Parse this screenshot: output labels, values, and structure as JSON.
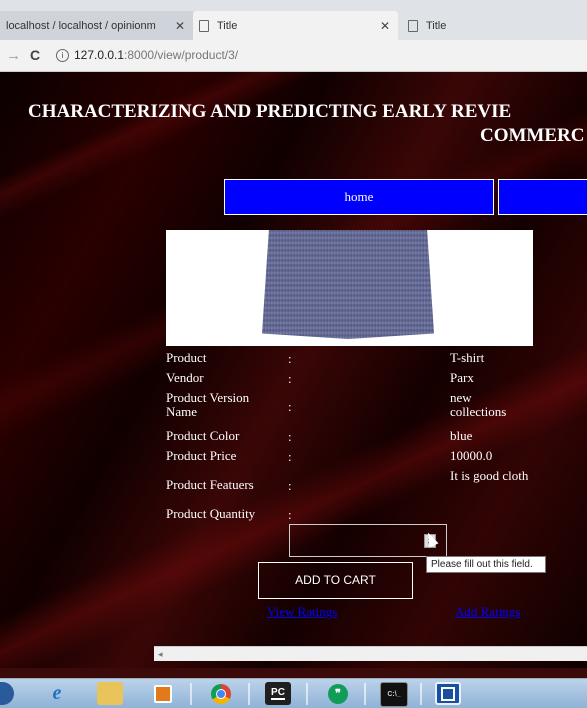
{
  "browser": {
    "tabs": [
      {
        "label": "localhost / localhost / opinionm"
      },
      {
        "label": "Title"
      },
      {
        "label": "Title"
      }
    ],
    "url_host": "127.0.0.1",
    "url_path": ":8000/view/product/3/"
  },
  "page": {
    "title_line1": "CHARACTERIZING AND PREDICTING EARLY REVIE",
    "title_line2": "COMMERC",
    "nav": {
      "home": "home"
    },
    "product": {
      "rows": [
        {
          "label": "Product",
          "sep": ":",
          "value": "T-shirt"
        },
        {
          "label": "Vendor",
          "sep": ":",
          "value": "Parx"
        },
        {
          "label": "Product Version Name",
          "sep": ":",
          "value": "new collections"
        },
        {
          "label": "Product Color",
          "sep": ":",
          "value": "blue"
        },
        {
          "label": "Product Price",
          "sep": ":",
          "value": "10000.0"
        },
        {
          "label": "Product Featuers",
          "sep": ":",
          "value": "It is good cloth"
        },
        {
          "label": "Product Quantity",
          "sep": ":",
          "value": ""
        }
      ]
    },
    "quantity_tooltip": "Please fill out this field.",
    "add_to_cart": "ADD TO CART",
    "view_ratings": "View Ratings",
    "add_ratings": "Add Ratings"
  },
  "taskbar": {
    "icons": [
      "windows-start-icon",
      "internet-explorer-icon",
      "file-explorer-icon",
      "outlook-icon",
      "chrome-icon",
      "pycharm-icon",
      "hangouts-icon",
      "command-prompt-icon",
      "app-window-icon"
    ]
  },
  "colors": {
    "nav_blue": "#0000ff",
    "link_blue": "#0000ff",
    "background": "#1a0000"
  }
}
